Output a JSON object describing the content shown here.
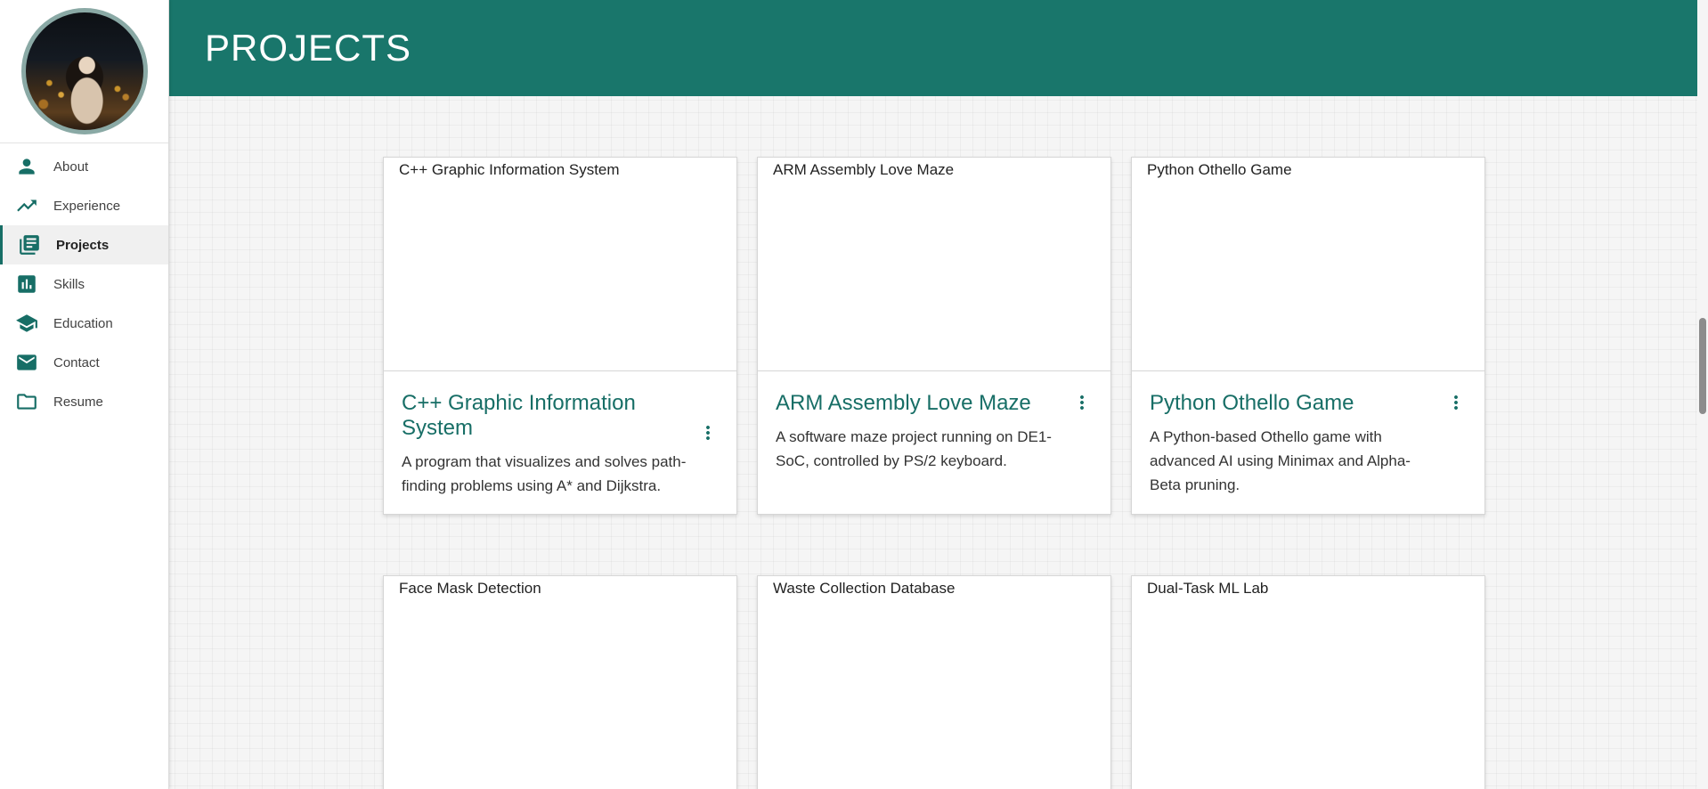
{
  "header": {
    "title": "PROJECTS"
  },
  "sidebar": {
    "items": [
      {
        "label": "About",
        "icon": "person-icon"
      },
      {
        "label": "Experience",
        "icon": "trending-up-icon"
      },
      {
        "label": "Projects",
        "icon": "library-books-icon",
        "active": true
      },
      {
        "label": "Skills",
        "icon": "bar-chart-icon"
      },
      {
        "label": "Education",
        "icon": "school-icon"
      },
      {
        "label": "Contact",
        "icon": "mail-icon"
      },
      {
        "label": "Resume",
        "icon": "folder-icon"
      }
    ]
  },
  "projects": [
    {
      "image_alt": "C++ Graphic Information System",
      "title": "C++ Graphic Information System",
      "description": "A program that visualizes and solves path-finding problems using A* and Dijkstra."
    },
    {
      "image_alt": "ARM Assembly Love Maze",
      "title": "ARM Assembly Love Maze",
      "description": "A software maze project running on DE1-SoC, controlled by PS/2 keyboard."
    },
    {
      "image_alt": "Python Othello Game",
      "title": "Python Othello Game",
      "description": "A Python-based Othello game with advanced AI using Minimax and Alpha-Beta pruning."
    },
    {
      "image_alt": "Face Mask Detection"
    },
    {
      "image_alt": "Waste Collection Database"
    },
    {
      "image_alt": "Dual-Task ML Lab"
    }
  ],
  "colors": {
    "accent": "#176e66",
    "header_bg": "#19766b"
  }
}
